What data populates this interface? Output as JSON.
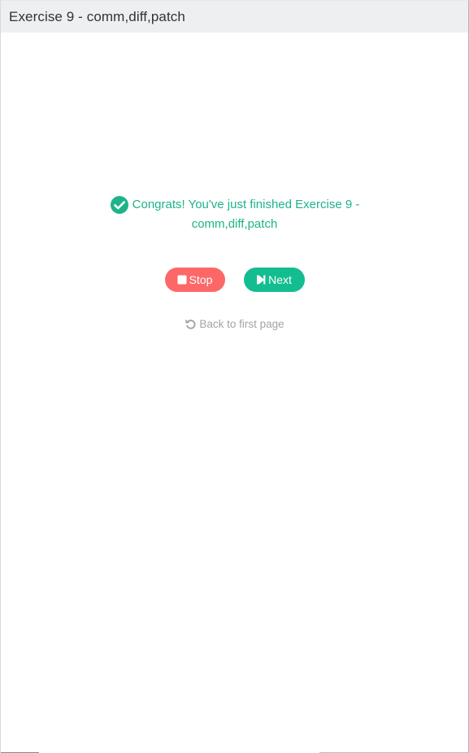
{
  "window": {
    "title": "Exercise 9 - comm,diff,patch"
  },
  "message": {
    "line1": "Congrats! You've just finished Exercise 9 -",
    "line2": "comm,diff,patch",
    "icon": "check-circle-icon"
  },
  "buttons": {
    "stop_label": "Stop",
    "next_label": "Next",
    "stop_icon": "stop-icon",
    "next_icon": "step-forward-icon"
  },
  "back": {
    "label": "Back to first page",
    "icon": "undo-icon"
  },
  "colors": {
    "success": "#1fb38a",
    "stop": "#fc6868",
    "next": "#14bd8f",
    "muted": "#a4a4a4",
    "titlebar": "#eeeff0"
  }
}
